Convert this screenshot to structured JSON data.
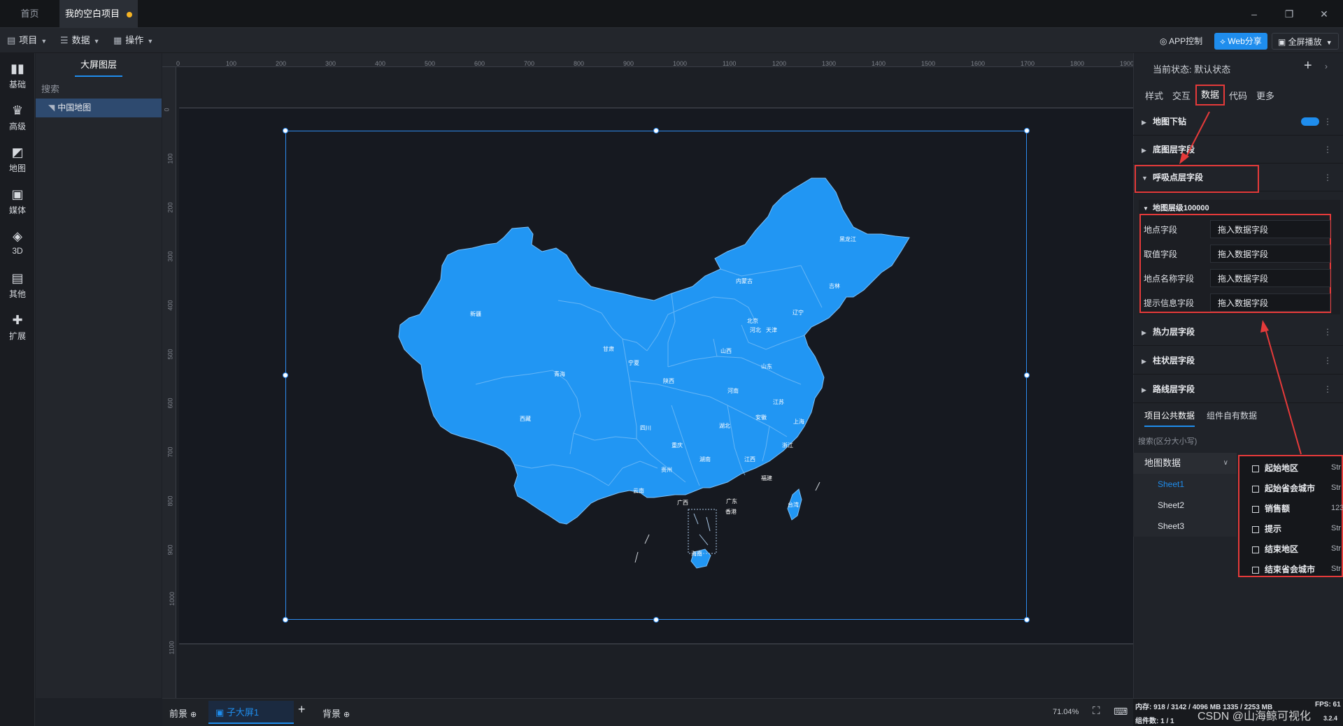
{
  "tabs": [
    {
      "label": "首页",
      "active": false
    },
    {
      "label": "我的空白项目",
      "active": true
    }
  ],
  "window_controls": [
    "–",
    "❐",
    "✕"
  ],
  "menus": {
    "project": "项目",
    "data": "数据",
    "operate": "操作"
  },
  "toolbar_right": {
    "app_control": "APP控制",
    "web_share": "Web分享",
    "fullscreen": "全屏播放"
  },
  "colors": {
    "accent": "#1f8ded",
    "map_fill": "#2196f3",
    "annotation_red": "#e53a3a"
  },
  "left_bar": [
    {
      "label": "基础",
      "icon": "bar-chart-icon"
    },
    {
      "label": "高级",
      "icon": "crown-icon"
    },
    {
      "label": "地图",
      "icon": "map-icon"
    },
    {
      "label": "媒体",
      "icon": "media-icon"
    },
    {
      "label": "3D",
      "icon": "cube-icon"
    },
    {
      "label": "其他",
      "icon": "stack-icon"
    },
    {
      "label": "扩展",
      "icon": "puzzle-icon"
    }
  ],
  "layers": {
    "title": "大屏图层",
    "search_placeholder": "搜索",
    "items": [
      {
        "label": "中国地图",
        "selected": true
      }
    ]
  },
  "ruler": {
    "h_ticks": [
      "0",
      "100",
      "200",
      "300",
      "400",
      "500",
      "600",
      "700",
      "800",
      "900",
      "1000",
      "1100",
      "1200",
      "1300",
      "1400",
      "1500",
      "1600",
      "1700",
      "1800",
      "1900"
    ],
    "v_ticks": [
      "0",
      "100",
      "200",
      "300",
      "400",
      "500",
      "600",
      "700",
      "800",
      "900",
      "1000",
      "1100"
    ]
  },
  "map": {
    "provinces": [
      "黑龙江",
      "吉林",
      "辽宁",
      "内蒙古",
      "北京",
      "河北",
      "天津",
      "山西",
      "山东",
      "河南",
      "江苏",
      "安徽",
      "上海",
      "浙江",
      "湖北",
      "湖南",
      "江西",
      "福建",
      "广东",
      "广西",
      "海南",
      "香港",
      "台湾",
      "贵州",
      "云南",
      "四川",
      "重庆",
      "陕西",
      "宁夏",
      "甘肃",
      "青海",
      "新疆",
      "西藏"
    ]
  },
  "bottom": {
    "foreground": "前景",
    "child_screen": "子大屏1",
    "background": "背景",
    "zoom": "71.04%"
  },
  "right_panel": {
    "state_label": "当前状态:",
    "state_value": "默认状态",
    "tabs": [
      {
        "label": "样式",
        "active": false
      },
      {
        "label": "交互",
        "active": false
      },
      {
        "label": "数据",
        "active": true
      },
      {
        "label": "代码",
        "active": false
      },
      {
        "label": "更多",
        "active": false
      }
    ],
    "sections": [
      {
        "label": "地图下钻",
        "expanded": false,
        "toggle": true
      },
      {
        "label": "底图层字段",
        "expanded": false
      },
      {
        "label": "呼吸点层字段",
        "expanded": true
      }
    ],
    "sub_section": "地图层级100000",
    "fields": [
      {
        "label": "地点字段",
        "value": "拖入数据字段"
      },
      {
        "label": "取值字段",
        "value": "拖入数据字段"
      },
      {
        "label": "地点名称字段",
        "value": "拖入数据字段"
      },
      {
        "label": "提示信息字段",
        "value": "拖入数据字段"
      }
    ],
    "sections_after": [
      {
        "label": "热力层字段"
      },
      {
        "label": "柱状层字段"
      },
      {
        "label": "路线层字段"
      }
    ],
    "data_tabs": [
      {
        "label": "项目公共数据",
        "active": true
      },
      {
        "label": "组件自有数据",
        "active": false
      }
    ],
    "search_placeholder": "搜索(区分大小写)",
    "data_source": "地图数据",
    "sheets": [
      {
        "label": "Sheet1",
        "active": true
      },
      {
        "label": "Sheet2",
        "active": false
      },
      {
        "label": "Sheet3",
        "active": false
      }
    ],
    "columns": [
      {
        "label": "起始地区",
        "type": "Str"
      },
      {
        "label": "起始省会城市",
        "type": "Str"
      },
      {
        "label": "销售额",
        "type": "123"
      },
      {
        "label": "提示",
        "type": "Str"
      },
      {
        "label": "结束地区",
        "type": "Str"
      },
      {
        "label": "结束省会城市",
        "type": "Str"
      }
    ]
  },
  "status": {
    "memory": "内存: 918 / 3142 / 4096 MB 1335 / 2253 MB",
    "fps": "FPS: 61",
    "components": "组件数: 1 / 1",
    "version": "3.2.4",
    "watermark": "CSDN @山海鲸可视化"
  }
}
